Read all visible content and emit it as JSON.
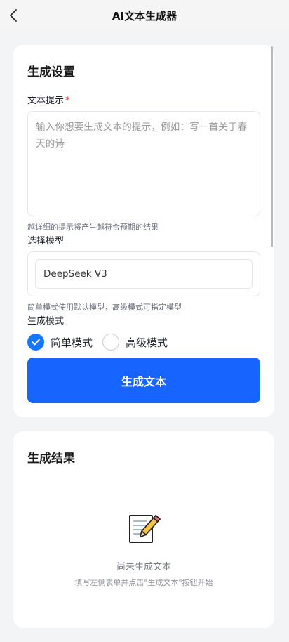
{
  "header": {
    "title": "AI文本生成器",
    "back_icon": "chevron-left-icon"
  },
  "settings": {
    "title": "生成设置",
    "prompt": {
      "label": "文本提示",
      "required_mark": "*",
      "value": "",
      "placeholder": "输入你想要生成文本的提示，例如：写一首关于春天的诗",
      "hint": "越详细的提示将产生越符合预期的结果"
    },
    "model": {
      "label": "选择模型",
      "value": "DeepSeek V3",
      "hint": "简单模式使用默认模型，高级模式可指定模型"
    },
    "mode": {
      "label": "生成模式",
      "options": [
        {
          "label": "简单模式",
          "checked": true
        },
        {
          "label": "高级模式",
          "checked": false
        }
      ]
    },
    "generate_button": "生成文本",
    "accent_color": "#1864ff"
  },
  "result": {
    "title": "生成结果",
    "empty_icon": "memo-pencil-icon",
    "empty_title": "尚未生成文本",
    "empty_desc": "填写左侧表单并点击\"生成文本\"按钮开始"
  }
}
